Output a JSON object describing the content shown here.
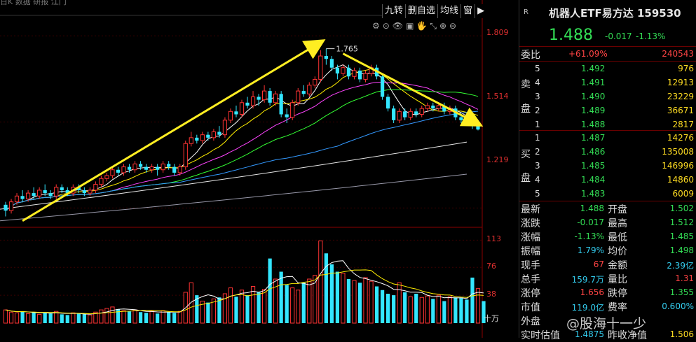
{
  "top_cut_text": "日K  数据  研报  江门",
  "toolbar": [
    "九转",
    "删自选",
    "均线",
    "窗"
  ],
  "tiny_toolbar": [
    "⚙",
    "⊙",
    "👁",
    "▣",
    "🖐",
    "⤡",
    "⊕",
    "⊖"
  ],
  "chart_data": {
    "type": "candlestick",
    "price_axis": {
      "ticks": [
        1.809,
        1.514,
        1.219
      ],
      "ylim": [
        1.16,
        1.86
      ]
    },
    "volume_axis": {
      "ticks": [
        113,
        76,
        38
      ],
      "unit": "十万",
      "ylim": [
        0,
        120
      ]
    },
    "high_annotation": "1.765",
    "candles": [
      [
        1.23,
        1.21,
        1.24,
        1.19
      ],
      [
        1.21,
        1.24,
        1.25,
        1.2
      ],
      [
        1.24,
        1.26,
        1.27,
        1.23
      ],
      [
        1.26,
        1.25,
        1.28,
        1.24
      ],
      [
        1.25,
        1.27,
        1.28,
        1.24
      ],
      [
        1.27,
        1.26,
        1.29,
        1.25
      ],
      [
        1.26,
        1.28,
        1.29,
        1.25
      ],
      [
        1.28,
        1.27,
        1.3,
        1.26
      ],
      [
        1.27,
        1.26,
        1.28,
        1.25
      ],
      [
        1.26,
        1.29,
        1.3,
        1.25
      ],
      [
        1.29,
        1.28,
        1.3,
        1.27
      ],
      [
        1.28,
        1.27,
        1.29,
        1.26
      ],
      [
        1.27,
        1.29,
        1.3,
        1.26
      ],
      [
        1.29,
        1.28,
        1.3,
        1.27
      ],
      [
        1.28,
        1.27,
        1.29,
        1.26
      ],
      [
        1.27,
        1.28,
        1.29,
        1.26
      ],
      [
        1.28,
        1.3,
        1.31,
        1.27
      ],
      [
        1.3,
        1.32,
        1.33,
        1.29
      ],
      [
        1.32,
        1.33,
        1.34,
        1.31
      ],
      [
        1.33,
        1.35,
        1.36,
        1.32
      ],
      [
        1.35,
        1.34,
        1.36,
        1.33
      ],
      [
        1.34,
        1.36,
        1.37,
        1.33
      ],
      [
        1.36,
        1.35,
        1.37,
        1.34
      ],
      [
        1.35,
        1.37,
        1.38,
        1.34
      ],
      [
        1.37,
        1.36,
        1.38,
        1.35
      ],
      [
        1.36,
        1.35,
        1.37,
        1.34
      ],
      [
        1.35,
        1.36,
        1.37,
        1.34
      ],
      [
        1.36,
        1.35,
        1.37,
        1.33
      ],
      [
        1.35,
        1.37,
        1.38,
        1.34
      ],
      [
        1.37,
        1.36,
        1.38,
        1.35
      ],
      [
        1.36,
        1.34,
        1.37,
        1.33
      ],
      [
        1.34,
        1.36,
        1.37,
        1.33
      ],
      [
        1.36,
        1.44,
        1.45,
        1.35
      ],
      [
        1.44,
        1.46,
        1.48,
        1.43
      ],
      [
        1.46,
        1.45,
        1.47,
        1.44
      ],
      [
        1.45,
        1.47,
        1.48,
        1.44
      ],
      [
        1.47,
        1.46,
        1.48,
        1.45
      ],
      [
        1.46,
        1.48,
        1.49,
        1.45
      ],
      [
        1.48,
        1.47,
        1.5,
        1.46
      ],
      [
        1.47,
        1.52,
        1.53,
        1.46
      ],
      [
        1.52,
        1.55,
        1.56,
        1.51
      ],
      [
        1.55,
        1.54,
        1.57,
        1.53
      ],
      [
        1.54,
        1.58,
        1.59,
        1.53
      ],
      [
        1.58,
        1.57,
        1.6,
        1.56
      ],
      [
        1.57,
        1.6,
        1.62,
        1.56
      ],
      [
        1.6,
        1.59,
        1.61,
        1.57
      ],
      [
        1.59,
        1.62,
        1.64,
        1.58
      ],
      [
        1.62,
        1.58,
        1.63,
        1.57
      ],
      [
        1.58,
        1.61,
        1.62,
        1.57
      ],
      [
        1.61,
        1.54,
        1.62,
        1.53
      ],
      [
        1.54,
        1.53,
        1.56,
        1.51
      ],
      [
        1.53,
        1.58,
        1.59,
        1.52
      ],
      [
        1.58,
        1.62,
        1.63,
        1.57
      ],
      [
        1.62,
        1.61,
        1.64,
        1.6
      ],
      [
        1.61,
        1.64,
        1.65,
        1.6
      ],
      [
        1.64,
        1.66,
        1.67,
        1.63
      ],
      [
        1.66,
        1.74,
        1.76,
        1.65
      ],
      [
        1.74,
        1.73,
        1.765,
        1.71
      ],
      [
        1.73,
        1.7,
        1.74,
        1.69
      ],
      [
        1.7,
        1.68,
        1.71,
        1.66
      ],
      [
        1.68,
        1.7,
        1.71,
        1.67
      ],
      [
        1.7,
        1.67,
        1.71,
        1.66
      ],
      [
        1.67,
        1.69,
        1.7,
        1.66
      ],
      [
        1.69,
        1.66,
        1.7,
        1.65
      ],
      [
        1.66,
        1.68,
        1.69,
        1.65
      ],
      [
        1.68,
        1.7,
        1.71,
        1.67
      ],
      [
        1.7,
        1.67,
        1.71,
        1.66
      ],
      [
        1.67,
        1.6,
        1.68,
        1.59
      ],
      [
        1.6,
        1.56,
        1.61,
        1.55
      ],
      [
        1.56,
        1.52,
        1.57,
        1.51
      ],
      [
        1.52,
        1.55,
        1.56,
        1.51
      ],
      [
        1.55,
        1.53,
        1.56,
        1.52
      ],
      [
        1.53,
        1.55,
        1.56,
        1.52
      ],
      [
        1.55,
        1.54,
        1.56,
        1.53
      ],
      [
        1.54,
        1.56,
        1.57,
        1.53
      ],
      [
        1.56,
        1.57,
        1.58,
        1.55
      ],
      [
        1.57,
        1.56,
        1.58,
        1.55
      ],
      [
        1.56,
        1.57,
        1.58,
        1.55
      ],
      [
        1.57,
        1.55,
        1.58,
        1.54
      ],
      [
        1.55,
        1.56,
        1.57,
        1.54
      ],
      [
        1.56,
        1.53,
        1.57,
        1.52
      ],
      [
        1.53,
        1.52,
        1.54,
        1.51
      ],
      [
        1.52,
        1.51,
        1.53,
        1.5
      ],
      [
        1.51,
        1.5,
        1.52,
        1.49
      ],
      [
        1.502,
        1.488,
        1.512,
        1.485
      ]
    ],
    "volumes": [
      18,
      15,
      14,
      16,
      13,
      15,
      12,
      14,
      13,
      16,
      12,
      11,
      14,
      13,
      12,
      11,
      15,
      18,
      20,
      22,
      19,
      17,
      16,
      18,
      15,
      14,
      16,
      13,
      17,
      15,
      14,
      16,
      42,
      55,
      38,
      30,
      28,
      33,
      35,
      40,
      48,
      36,
      45,
      38,
      50,
      42,
      46,
      88,
      60,
      70,
      52,
      48,
      45,
      55,
      60,
      65,
      112,
      95,
      80,
      70,
      68,
      60,
      58,
      55,
      62,
      57,
      50,
      45,
      40,
      38,
      55,
      42,
      36,
      40,
      35,
      37,
      33,
      38,
      30,
      36,
      35,
      34,
      32,
      62,
      47,
      30
    ],
    "volume_red": [
      true,
      true,
      true,
      false,
      true,
      false,
      true,
      false,
      false,
      true,
      false,
      false,
      true,
      false,
      false,
      true,
      true,
      true,
      true,
      true,
      false,
      true,
      false,
      true,
      false,
      false,
      true,
      false,
      true,
      false,
      false,
      true,
      true,
      true,
      false,
      true,
      false,
      true,
      false,
      true,
      true,
      false,
      true,
      false,
      true,
      false,
      true,
      false,
      true,
      false,
      false,
      true,
      true,
      false,
      true,
      true,
      true,
      false,
      false,
      false,
      true,
      false,
      true,
      false,
      true,
      true,
      false,
      false,
      false,
      false,
      true,
      false,
      true,
      false,
      true,
      true,
      false,
      true,
      false,
      true,
      false,
      false,
      false,
      false,
      true,
      false
    ]
  },
  "panel": {
    "r_label": "R",
    "title": "机器人ETF易方达 159530",
    "price": "1.488",
    "change": "-0.017",
    "change_pct": "-1.13%",
    "weibi_label": "委比",
    "weibi_pct": "+61.09%",
    "weibi_val": "240543",
    "sell_label": [
      "卖",
      "盘"
    ],
    "buy_label": [
      "买",
      "盘"
    ],
    "sell": [
      {
        "n": "5",
        "p": "1.492",
        "v": "976"
      },
      {
        "n": "4",
        "p": "1.491",
        "v": "12913"
      },
      {
        "n": "3",
        "p": "1.490",
        "v": "23229"
      },
      {
        "n": "2",
        "p": "1.489",
        "v": "36671"
      },
      {
        "n": "1",
        "p": "1.488",
        "v": "2817"
      }
    ],
    "buy": [
      {
        "n": "1",
        "p": "1.487",
        "v": "14276"
      },
      {
        "n": "2",
        "p": "1.486",
        "v": "135008"
      },
      {
        "n": "3",
        "p": "1.485",
        "v": "146996"
      },
      {
        "n": "4",
        "p": "1.484",
        "v": "14860"
      },
      {
        "n": "5",
        "p": "1.483",
        "v": "6009"
      }
    ],
    "stats": [
      {
        "l1": "最新",
        "v1": "1.488",
        "c1": "green",
        "l2": "开盘",
        "v2": "1.502",
        "c2": "green"
      },
      {
        "l1": "涨跌",
        "v1": "-0.017",
        "c1": "green",
        "l2": "最高",
        "v2": "1.512",
        "c2": "green"
      },
      {
        "l1": "涨幅",
        "v1": "-1.13%",
        "c1": "green",
        "l2": "最低",
        "v2": "1.485",
        "c2": "green"
      },
      {
        "l1": "振幅",
        "v1": "1.79%",
        "c1": "cyan",
        "l2": "均价",
        "v2": "1.498",
        "c2": "green"
      },
      {
        "l1": "现手",
        "v1": "67",
        "c1": "red",
        "l2": "金额",
        "v2": "2.39亿",
        "c2": "cyan"
      },
      {
        "l1": "总手",
        "v1": "159.7万",
        "c1": "cyan",
        "l2": "量比",
        "v2": "1.31",
        "c2": "red"
      },
      {
        "l1": "涨停",
        "v1": "1.656",
        "c1": "red",
        "l2": "跌停",
        "v2": "1.355",
        "c2": "green"
      },
      {
        "l1": "市值",
        "v1": "119.0亿",
        "c1": "cyan",
        "l2": "费率",
        "v2": "0.600%",
        "c2": "cyan"
      },
      {
        "l1": "外盘",
        "v1": "",
        "c1": "red",
        "l2": "",
        "v2": "",
        "c2": "green"
      },
      {
        "l1": "实时估值",
        "v1": "1.4875",
        "c1": "cyan",
        "l2": "昨收净值",
        "v2": "1.506",
        "c2": "yellow"
      }
    ]
  },
  "watermark": "@股海十一少",
  "colors": {
    "up": "#ff3333",
    "down": "#33e6ff",
    "arrow": "#ffee22",
    "axis": "#8b0000"
  }
}
